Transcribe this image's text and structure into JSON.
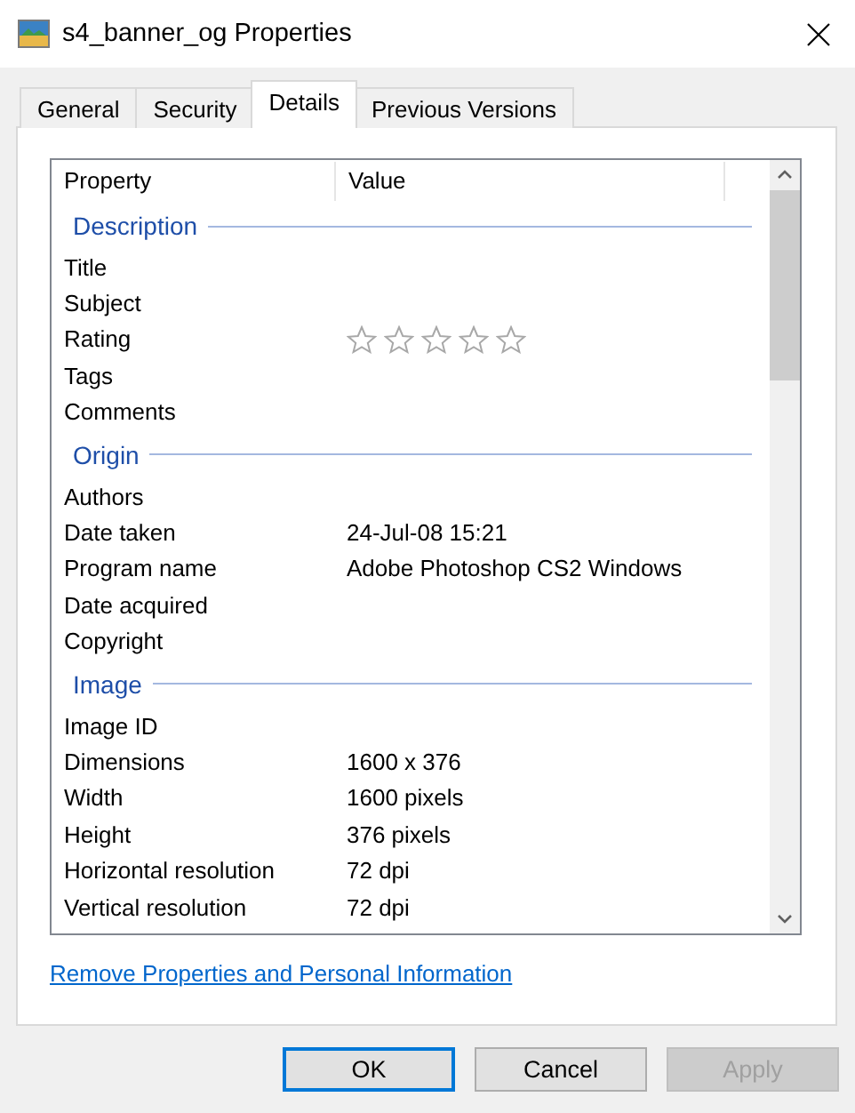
{
  "window": {
    "title": "s4_banner_og Properties"
  },
  "tabs": [
    {
      "label": "General",
      "selected": false
    },
    {
      "label": "Security",
      "selected": false
    },
    {
      "label": "Details",
      "selected": true
    },
    {
      "label": "Previous Versions",
      "selected": false
    }
  ],
  "columns": [
    "Property",
    "Value"
  ],
  "sections": [
    {
      "title": "Description",
      "rows": [
        {
          "kind": "text",
          "property": "Title"
        },
        {
          "kind": "text",
          "property": "Subject"
        },
        {
          "kind": "rating",
          "property": "Rating",
          "stars": 0
        },
        {
          "kind": "text",
          "property": "Tags"
        },
        {
          "kind": "text",
          "property": "Comments"
        }
      ]
    },
    {
      "title": "Origin",
      "rows": [
        {
          "kind": "text",
          "property": "Authors"
        },
        {
          "kind": "text",
          "property": "Date taken",
          "value": "24-Jul-08 15:21"
        },
        {
          "kind": "text",
          "property": "Program name",
          "value": "Adobe Photoshop CS2 Windows"
        },
        {
          "kind": "text",
          "property": "Date acquired"
        },
        {
          "kind": "text",
          "property": "Copyright"
        }
      ]
    },
    {
      "title": "Image",
      "rows": [
        {
          "kind": "text",
          "property": "Image ID"
        },
        {
          "kind": "text",
          "property": "Dimensions",
          "value": "1600 x 376"
        },
        {
          "kind": "text",
          "property": "Width",
          "value": "1600 pixels"
        },
        {
          "kind": "text",
          "property": "Height",
          "value": "376 pixels"
        },
        {
          "kind": "text",
          "property": "Horizontal resolution",
          "value": "72 dpi"
        },
        {
          "kind": "text",
          "property": "Vertical resolution",
          "value": "72 dpi"
        }
      ]
    }
  ],
  "link": "Remove Properties and Personal Information",
  "buttons": [
    {
      "label": "OK",
      "default": true,
      "disabled": false
    },
    {
      "label": "Cancel",
      "default": false,
      "disabled": false
    },
    {
      "label": "Apply",
      "default": false,
      "disabled": true
    }
  ]
}
